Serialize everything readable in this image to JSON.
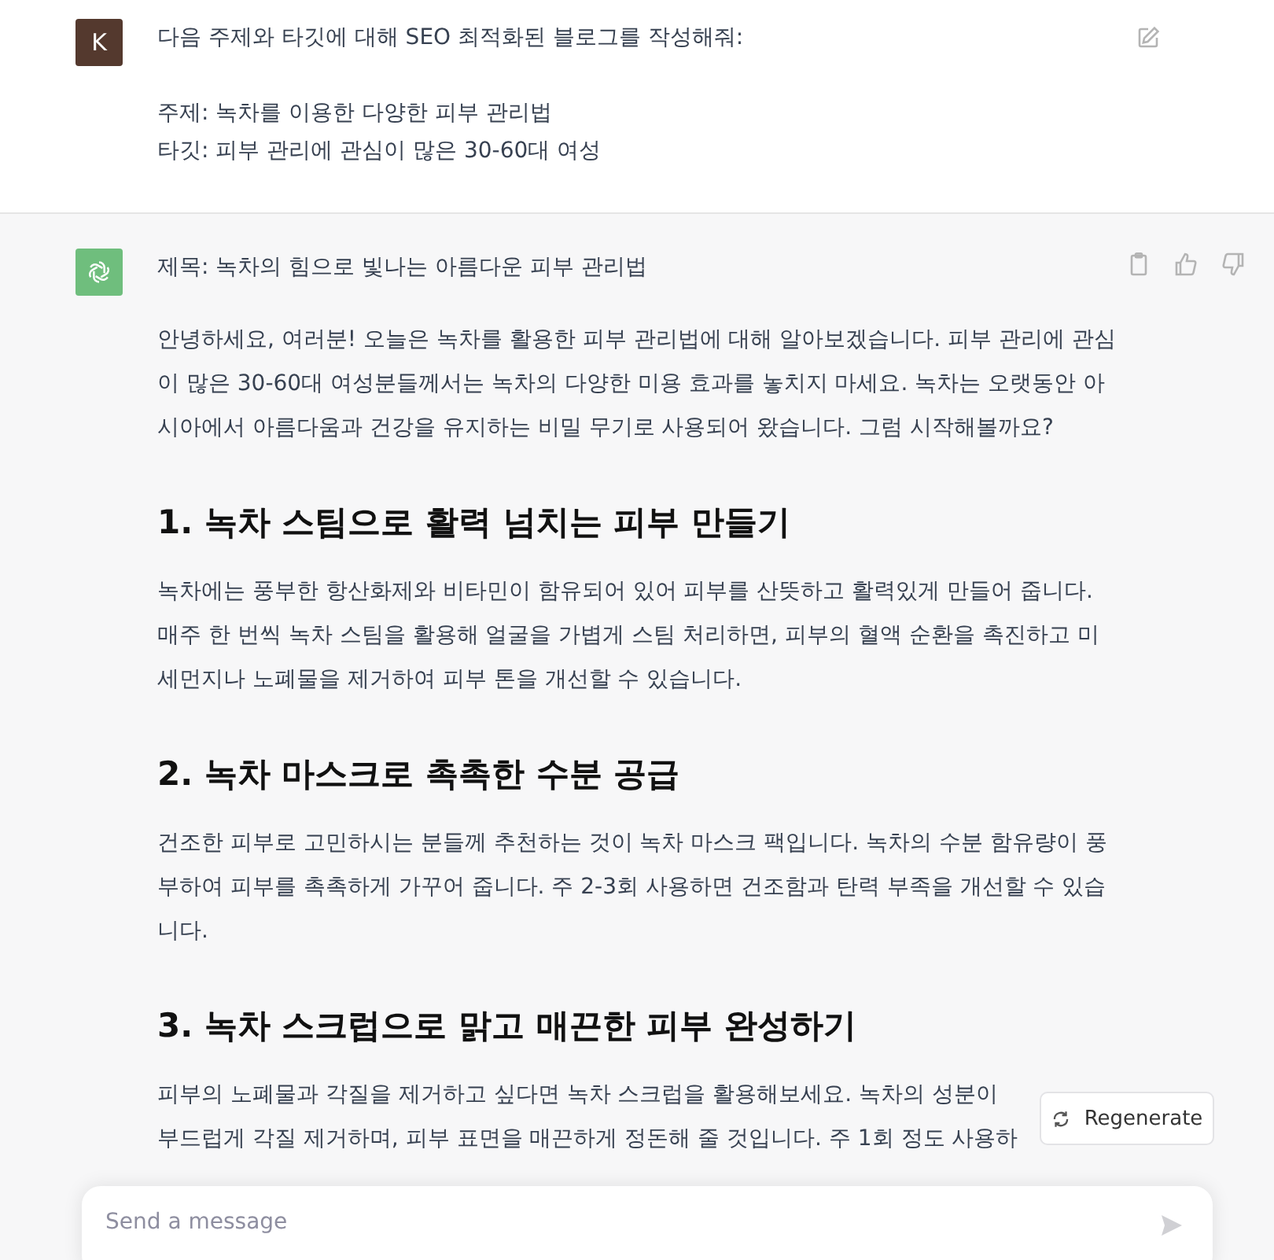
{
  "user_message": {
    "avatar": "K",
    "request": "다음 주제와 타깃에 대해 SEO 최적화된 블로그를 작성해줘:",
    "details": [
      "주제:  녹차를 이용한 다양한 피부 관리법",
      "타깃:  피부 관리에 관심이 많은 30-60대 여성"
    ]
  },
  "assistant_message": {
    "title": "제목: 녹차의 힘으로 빛나는 아름다운 피부 관리법",
    "blocks": [
      {
        "kind": "paragraph",
        "text": "안녕하세요, 여러분! 오늘은 녹차를 활용한 피부 관리법에 대해 알아보겠습니다. 피부 관리에 관심이 많은 30-60대 여성분들께서는 녹차의 다양한 미용 효과를 놓치지 마세요. 녹차는 오랫동안 아시아에서 아름다움과 건강을 유지하는 비밀 무기로 사용되어 왔습니다. 그럼 시작해볼까요?"
      },
      {
        "kind": "heading",
        "text": "1. 녹차 스팀으로 활력 넘치는 피부 만들기"
      },
      {
        "kind": "paragraph",
        "text": "녹차에는 풍부한 항산화제와 비타민이 함유되어 있어 피부를 산뜻하고 활력있게 만들어 줍니다. 매주 한 번씩 녹차 스팀을 활용해 얼굴을 가볍게 스팀 처리하면, 피부의 혈액 순환을 촉진하고 미세먼지나 노폐물을 제거하여 피부 톤을 개선할 수 있습니다."
      },
      {
        "kind": "heading",
        "text": "2. 녹차 마스크로 촉촉한 수분 공급"
      },
      {
        "kind": "paragraph",
        "text": "건조한 피부로 고민하시는 분들께 추천하는 것이 녹차 마스크 팩입니다. 녹차의 수분 함유량이 풍부하여 피부를 촉촉하게 가꾸어 줍니다. 주 2-3회 사용하면 건조함과 탄력 부족을 개선할 수 있습니다."
      },
      {
        "kind": "heading",
        "text": "3. 녹차 스크럽으로 맑고 매끈한 피부 완성하기"
      },
      {
        "kind": "cut_paragraph",
        "lines": [
          "피부의 노폐물과 각질을 제거하고 싶다면 녹차 스크럽을 활용해보세요. 녹차의 성분이",
          "부드럽게 각질 제거하며, 피부 표면을 매끈하게 정돈해 줄 것입니다. 주 1회 정도 사용하"
        ]
      }
    ]
  },
  "regenerate_button": "Regenerate",
  "message_input": {
    "placeholder": "Send a message"
  }
}
